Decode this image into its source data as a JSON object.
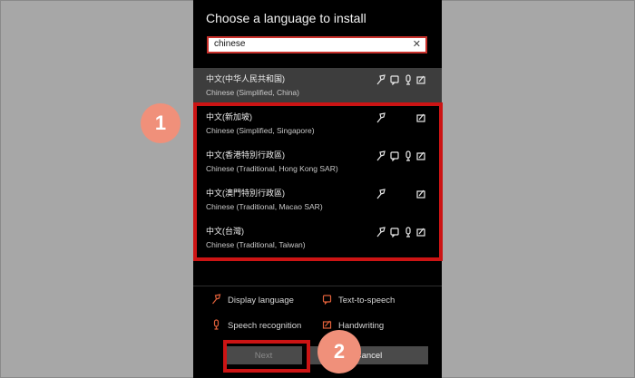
{
  "dialog": {
    "title": "Choose a language to install",
    "search": {
      "value": "chinese",
      "clear_icon": "close-icon"
    },
    "languages": [
      {
        "native": "中文(中华人民共和国)",
        "english": "Chinese (Simplified, China)",
        "selected": true,
        "features": [
          "display-language",
          "text-to-speech",
          "speech-recognition",
          "handwriting"
        ]
      },
      {
        "native": "中文(新加坡)",
        "english": "Chinese (Simplified, Singapore)",
        "selected": false,
        "features": [
          "display-language",
          "handwriting"
        ]
      },
      {
        "native": "中文(香港特別行政區)",
        "english": "Chinese (Traditional, Hong Kong SAR)",
        "selected": false,
        "features": [
          "display-language",
          "text-to-speech",
          "speech-recognition",
          "handwriting"
        ]
      },
      {
        "native": "中文(澳門特別行政區)",
        "english": "Chinese (Traditional, Macao SAR)",
        "selected": false,
        "features": [
          "display-language",
          "handwriting"
        ]
      },
      {
        "native": "中文(台灣)",
        "english": "Chinese (Traditional, Taiwan)",
        "selected": false,
        "features": [
          "display-language",
          "text-to-speech",
          "speech-recognition",
          "handwriting"
        ]
      }
    ],
    "legend": {
      "display_language": "Display language",
      "text_to_speech": "Text-to-speech",
      "speech_recognition": "Speech recognition",
      "handwriting": "Handwriting"
    },
    "buttons": {
      "next": "Next",
      "cancel": "Cancel"
    }
  },
  "annotations": {
    "step1": "1",
    "step2": "2"
  },
  "colors": {
    "accent_red": "#cc1414",
    "badge_salmon": "#f0907a",
    "legend_icon_orange": "#e0603a",
    "dialog_bg": "#000000",
    "page_bg": "#a7a7a7"
  }
}
